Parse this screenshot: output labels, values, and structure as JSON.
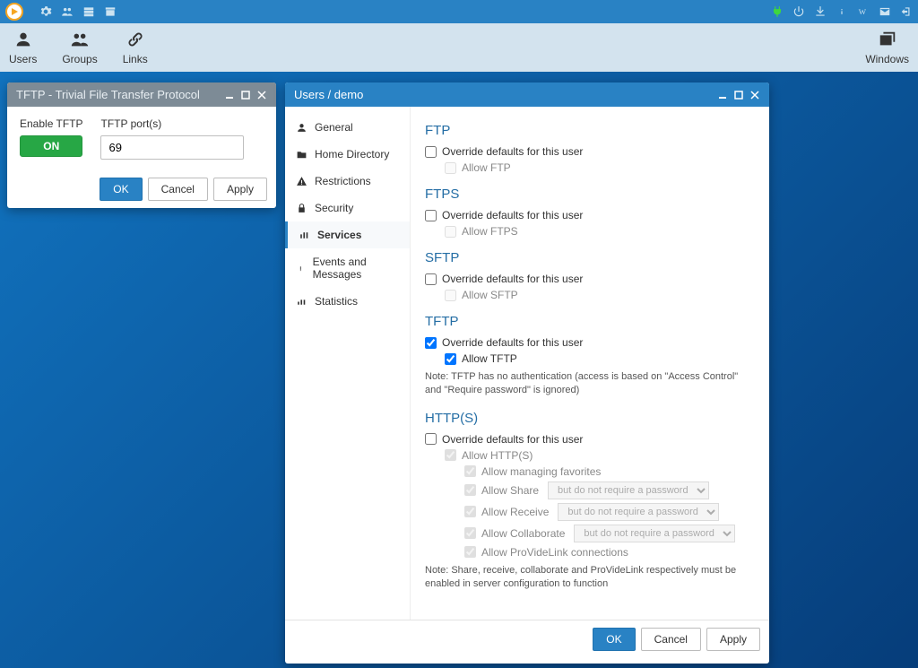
{
  "topbar": {
    "left_icons": [
      "play",
      "gear",
      "users",
      "server",
      "archive"
    ],
    "right_icons": [
      "plug",
      "power",
      "download",
      "info",
      "wikipedia",
      "mail",
      "logout"
    ]
  },
  "toolbar": {
    "users_label": "Users",
    "groups_label": "Groups",
    "links_label": "Links",
    "windows_label": "Windows"
  },
  "tftp_window": {
    "title": "TFTP - Trivial File Transfer Protocol",
    "enable_label": "Enable TFTP",
    "toggle_label": "ON",
    "ports_label": "TFTP port(s)",
    "port_value": "69",
    "ok_label": "OK",
    "cancel_label": "Cancel",
    "apply_label": "Apply"
  },
  "users_window": {
    "title": "Users / demo",
    "sidebar": {
      "general": "General",
      "home": "Home Directory",
      "restrictions": "Restrictions",
      "security": "Security",
      "services": "Services",
      "events": "Events and Messages",
      "statistics": "Statistics"
    },
    "services": {
      "ftp": {
        "heading": "FTP",
        "override": "Override defaults for this user",
        "allow": "Allow FTP"
      },
      "ftps": {
        "heading": "FTPS",
        "override": "Override defaults for this user",
        "allow": "Allow FTPS"
      },
      "sftp": {
        "heading": "SFTP",
        "override": "Override defaults for this user",
        "allow": "Allow SFTP"
      },
      "tftp": {
        "heading": "TFTP",
        "override": "Override defaults for this user",
        "allow": "Allow TFTP",
        "note": "Note: TFTP has no authentication (access is based on \"Access Control\" and \"Require password\" is ignored)"
      },
      "https": {
        "heading": "HTTP(S)",
        "override": "Override defaults for this user",
        "allow": "Allow HTTP(S)",
        "favorites": "Allow managing favorites",
        "share": "Allow Share",
        "receive": "Allow Receive",
        "collaborate": "Allow Collaborate",
        "providelink": "Allow ProVideLink connections",
        "pw_option": "but do not require a password",
        "note": "Note: Share, receive, collaborate and ProVideLink respectively must be enabled in server configuration to function"
      }
    },
    "ok_label": "OK",
    "cancel_label": "Cancel",
    "apply_label": "Apply"
  }
}
